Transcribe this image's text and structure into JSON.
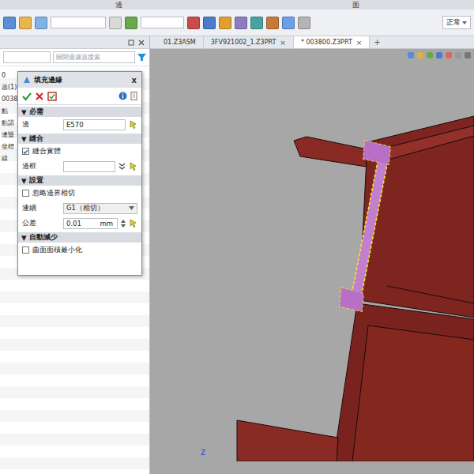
{
  "ribbon": {
    "groups": [
      "邊",
      "面"
    ],
    "display_mode": "正常"
  },
  "tabs": [
    {
      "label": "01.Z3ASM",
      "selected": false,
      "closable": false,
      "close": ""
    },
    {
      "label": "3FV921002_1.Z3PRT",
      "selected": false,
      "closable": true,
      "close": "×"
    },
    {
      "label": "* 003800.Z3PRT",
      "selected": true,
      "closable": true,
      "close": "×"
    }
  ],
  "new_tab": "+",
  "sidebar": {
    "search_placeholder": "關閉過濾器搜索",
    "items": [
      {
        "label": "0"
      },
      {
        "label": "器(1)"
      },
      {
        "label": "0038"
      },
      {
        "label": "點"
      },
      {
        "label": "點認"
      },
      {
        "label": "邊暨"
      },
      {
        "label": "坐標"
      },
      {
        "label": "線"
      }
    ]
  },
  "dialog": {
    "title": "填充邊緣",
    "close": "x",
    "sections": [
      {
        "title": "必需",
        "marker": "▼",
        "expanded": true,
        "rows": [
          {
            "kind": "pick",
            "label": "邊",
            "value": "E570"
          }
        ]
      },
      {
        "title": "縫合",
        "marker": "▼",
        "expanded": true,
        "rows": [
          {
            "kind": "checkbox",
            "label": "縫合實體",
            "checked": true
          },
          {
            "kind": "picklist",
            "label": "邊框",
            "value": ""
          }
        ]
      },
      {
        "title": "設置",
        "marker": "▼",
        "expanded": true,
        "rows": [
          {
            "kind": "checkbox",
            "label": "忽略邊界相切",
            "checked": false
          },
          {
            "kind": "dropdown",
            "label": "連續",
            "value": "G1（相切）"
          },
          {
            "kind": "number",
            "label": "公差",
            "value": "0.01",
            "unit": "mm"
          }
        ]
      },
      {
        "title": "自動減少",
        "marker": "▼",
        "expanded": true,
        "rows": [
          {
            "kind": "checkbox",
            "label": "曲面面積最小化",
            "checked": false
          }
        ]
      }
    ]
  },
  "viewport": {
    "axis_label": "Z"
  }
}
